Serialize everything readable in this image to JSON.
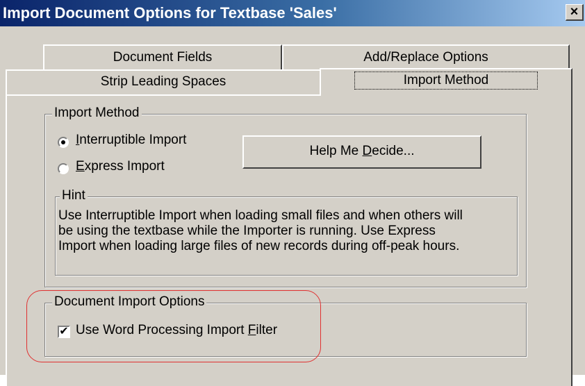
{
  "window": {
    "title": "Import Document Options for Textbase 'Sales'",
    "close_label": "×"
  },
  "tabs": {
    "row1": [
      "Document Fields",
      "Add/Replace Options"
    ],
    "row2": [
      "Strip Leading Spaces",
      "Import Method"
    ],
    "selected": "Import Method"
  },
  "import_method": {
    "group_label": "Import Method",
    "options": [
      {
        "label": "Interruptible Import",
        "accel": "I",
        "rest": "nterruptible Import",
        "selected": true
      },
      {
        "label": "Express Import",
        "accel": "E",
        "rest": "xpress Import",
        "selected": false
      }
    ],
    "help_button": {
      "before": "Help Me ",
      "accel": "D",
      "after": "ecide..."
    }
  },
  "hint": {
    "group_label": "Hint",
    "lines": [
      "Use Interruptible Import when loading small files and when others will",
      "be using the textbase while the Importer is running. Use Express",
      "Import when loading large files of new records during off-peak hours."
    ]
  },
  "document_import_options": {
    "group_label": "Document Import Options",
    "checkbox": {
      "before": "Use Word Processing Import ",
      "accel": "F",
      "after": "ilter",
      "checked": true,
      "mark": "✔"
    }
  },
  "colors": {
    "title_start": "#0a246a",
    "title_end": "#a6caf0",
    "face": "#d4d0c8",
    "annotation": "#e03030"
  }
}
